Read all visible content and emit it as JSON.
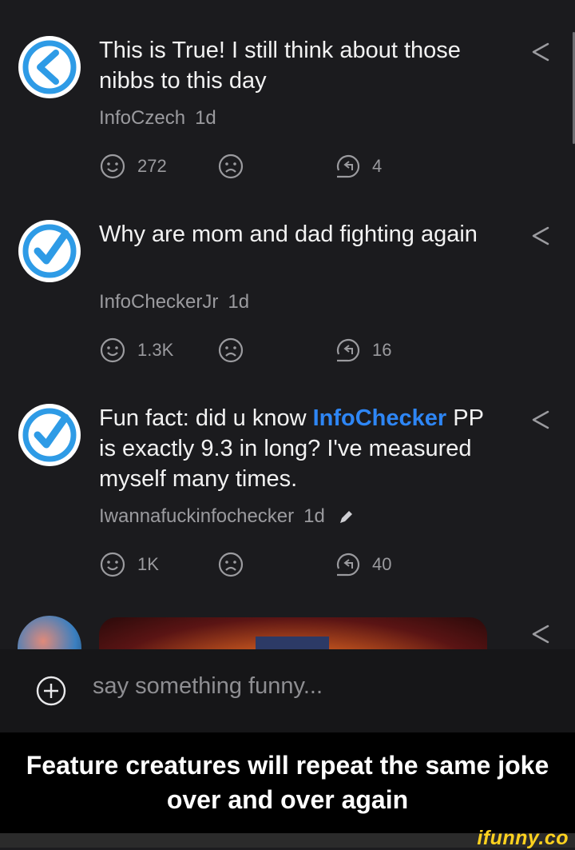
{
  "comments": [
    {
      "avatar": "infoczech-back-arrow-logo",
      "text": "This is True! I still think about those nibbs to this day",
      "author": "InfoCzech",
      "time": "1d",
      "smile_count": "272",
      "reply_count": "4"
    },
    {
      "avatar": "infochecker-checkmark-logo",
      "text": "Why are mom and dad fighting again",
      "author": "InfoCheckerJr",
      "time": "1d",
      "smile_count": "1.3K",
      "reply_count": "16"
    },
    {
      "avatar": "infochecker-checkmark-logo",
      "text_before": "Fun fact: did u know ",
      "mention": "InfoChecker",
      "text_after": " PP is exactly 9.3 in long? I've measured myself many times.",
      "author": "Iwannafuckinfochecker",
      "time": "1d",
      "edited_icon": "pen-icon",
      "smile_count": "1K",
      "reply_count": "40"
    }
  ],
  "composer": {
    "placeholder": "say something funny..."
  },
  "caption": "Feature creatures will repeat the same joke over and over again",
  "watermark": "ifunny.co",
  "colors": {
    "background": "#1b1b1e",
    "accent_blue": "#2e86f5",
    "logo_blue": "#2e9be6",
    "meta_gray": "#9b9b9f",
    "watermark_yellow": "#ffd21f"
  }
}
